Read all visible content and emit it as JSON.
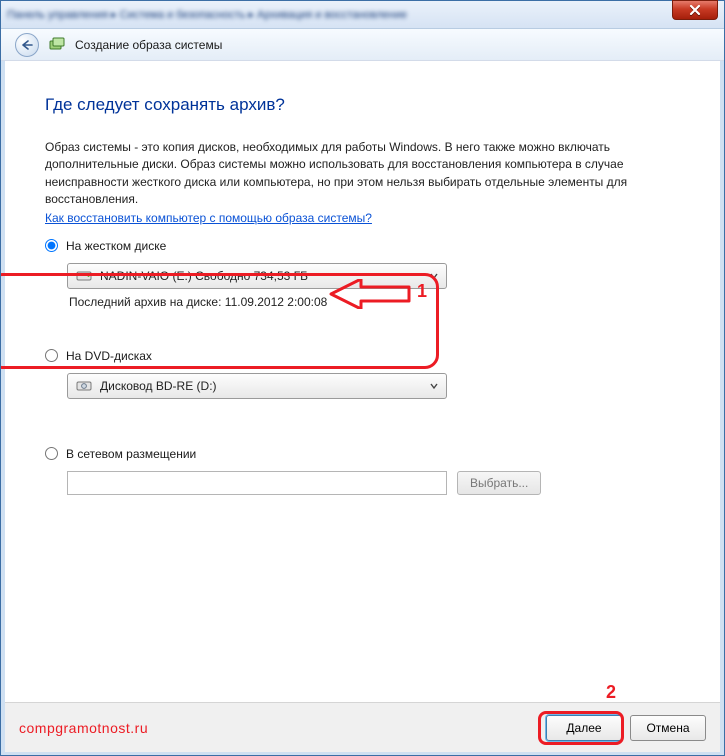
{
  "parent_breadcrumb": "Панель управления  ▸  Система и безопасность  ▸  Архивация и восстановление",
  "wizard": {
    "title": "Создание образа системы",
    "question": "Где следует сохранять архив?",
    "description": "Образ системы - это копия дисков, необходимых для работы Windows. В него также можно включать дополнительные диски. Образ системы можно использовать для восстановления компьютера в случае неисправности жесткого диска или компьютера, но при этом нельзя выбирать отдельные элементы для восстановления.",
    "help_link": "Как восстановить компьютер с помощью образа системы?"
  },
  "options": {
    "hard_disk": {
      "label": "На жестком диске",
      "checked": true,
      "drive_text": "NADIN-VAIO (E:)  Свободно 734,53 ГБ",
      "last_backup_prefix": "Последний архив на диске:",
      "last_backup_value": "11.09.2012 2:00:08"
    },
    "dvd": {
      "label": "На DVD-дисках",
      "checked": false,
      "drive_text": "Дисковод BD-RE (D:)"
    },
    "network": {
      "label": "В сетевом размещении",
      "checked": false,
      "path": "",
      "browse_label": "Выбрать..."
    }
  },
  "footer": {
    "watermark": "compgramotnost.ru",
    "next": "Далее",
    "cancel": "Отмена"
  },
  "annotations": {
    "label1": "1",
    "label2": "2"
  }
}
